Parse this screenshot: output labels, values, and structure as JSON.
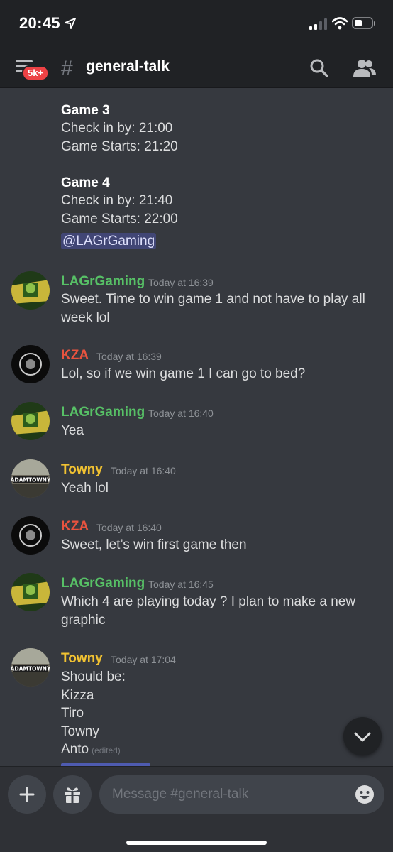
{
  "status_bar": {
    "time": "20:45"
  },
  "header": {
    "badge": "5k+",
    "channel_name": "general-talk"
  },
  "chat": {
    "pinned_block": {
      "game3_title": "Game 3",
      "game3_checkin": "Check in by: 21:00",
      "game3_start": "Game Starts: 21:20",
      "game4_title": "Game 4",
      "game4_checkin": "Check in by: 21:40",
      "game4_start": "Game Starts: 22:00",
      "mention": "@LAGrGaming"
    },
    "messages": [
      {
        "author": "LAGrGaming",
        "time": "Today at 16:39",
        "lines": [
          "Sweet. Time to win game 1 and not have to play all",
          "week lol"
        ]
      },
      {
        "author": "KZA",
        "time": "Today at 16:39",
        "lines": [
          "Lol, so if we win game 1 I can go to bed?"
        ]
      },
      {
        "author": "LAGrGaming",
        "time": "Today at 16:40",
        "lines": [
          "Yea"
        ]
      },
      {
        "author": "Towny",
        "time": "Today at 16:40",
        "lines": [
          "Yeah lol"
        ]
      },
      {
        "author": "KZA",
        "time": "Today at 16:40",
        "lines": [
          "Sweet, let’s win first game then"
        ]
      },
      {
        "author": "LAGrGaming",
        "time": "Today at 16:45",
        "lines": [
          "Which 4 are playing today ? I plan to make a new",
          "graphic"
        ]
      },
      {
        "author": "Towny",
        "time": "Today at 17:04",
        "lines": [
          "Should be:",
          "Kizza",
          "Tiro",
          "Towny",
          "Anto"
        ],
        "edited": "(edited)"
      }
    ]
  },
  "composer": {
    "placeholder": "Message #general-talk"
  },
  "colors": {
    "background": "#36393f",
    "header": "#202225",
    "lagr_name": "#57c066",
    "kza_name": "#e8533f",
    "towny_name": "#f1c232",
    "mention_bg": "#414675"
  },
  "icons": [
    "location-arrow-icon",
    "signal-icon",
    "wifi-icon",
    "battery-icon",
    "channels-menu-icon",
    "hash-icon",
    "search-icon",
    "members-icon",
    "chevron-down-icon",
    "plus-icon",
    "gift-icon",
    "emoji-icon"
  ]
}
